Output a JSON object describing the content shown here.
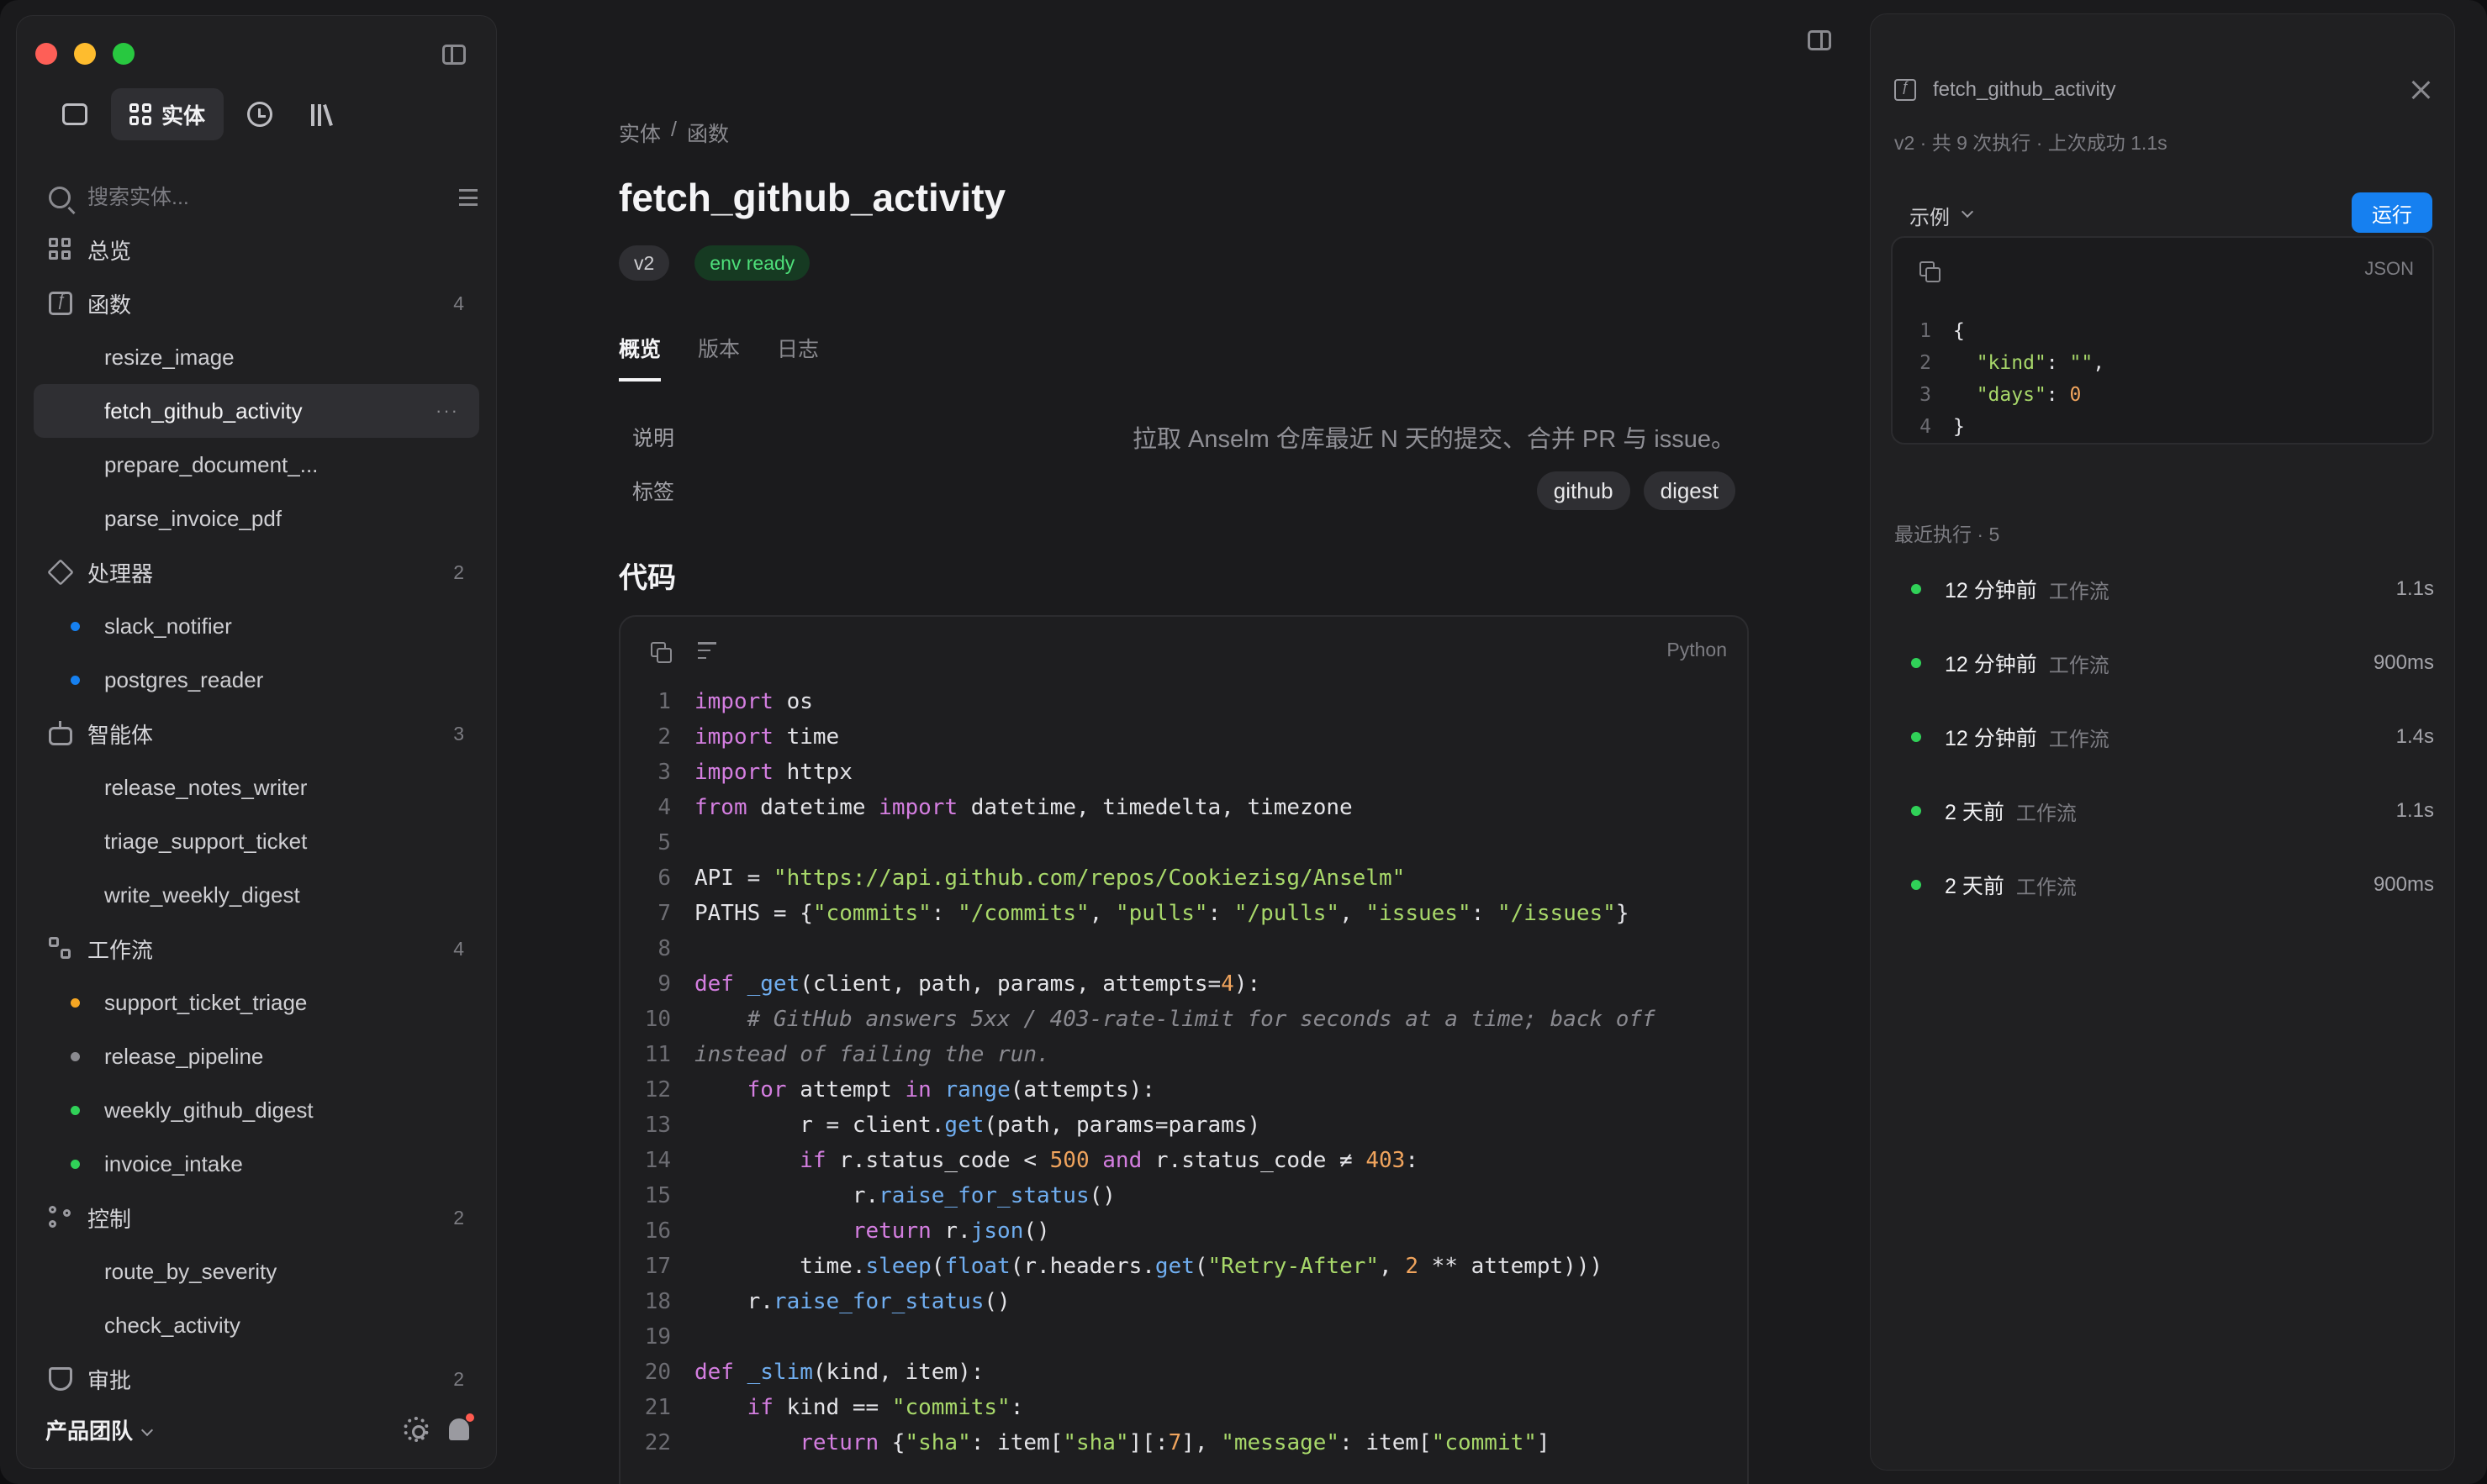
{
  "sidebar": {
    "modes": {
      "entities_label": "实体"
    },
    "search_placeholder": "搜索实体...",
    "overview": "总览",
    "groups": [
      {
        "label": "函数",
        "count": "4",
        "items": [
          {
            "label": "resize_image"
          },
          {
            "label": "fetch_github_activity",
            "selected": true
          },
          {
            "label": "prepare_document_..."
          },
          {
            "label": "parse_invoice_pdf"
          }
        ]
      },
      {
        "label": "处理器",
        "count": "2",
        "items": [
          {
            "label": "slack_notifier",
            "dot": "#1680f0"
          },
          {
            "label": "postgres_reader",
            "dot": "#1680f0"
          }
        ]
      },
      {
        "label": "智能体",
        "count": "3",
        "items": [
          {
            "label": "release_notes_writer"
          },
          {
            "label": "triage_support_ticket"
          },
          {
            "label": "write_weekly_digest"
          }
        ]
      },
      {
        "label": "工作流",
        "count": "4",
        "items": [
          {
            "label": "support_ticket_triage",
            "dot": "#f5a623"
          },
          {
            "label": "release_pipeline",
            "dot": "#8a8a8f"
          },
          {
            "label": "weekly_github_digest",
            "dot": "#30d158"
          },
          {
            "label": "invoice_intake",
            "dot": "#30d158"
          }
        ]
      },
      {
        "label": "控制",
        "count": "2",
        "items": [
          {
            "label": "route_by_severity"
          },
          {
            "label": "check_activity"
          }
        ]
      },
      {
        "label": "审批",
        "count": "2",
        "items": []
      }
    ],
    "footer": {
      "team": "产品团队"
    }
  },
  "main": {
    "breadcrumb": [
      "实体",
      "/",
      "函数"
    ],
    "title": "fetch_github_activity",
    "badges": {
      "version": "v2",
      "env": "env ready"
    },
    "tabs": [
      "概览",
      "版本",
      "日志"
    ],
    "props": {
      "desc_label": "说明",
      "desc_value": "拉取 Anselm 仓库最近 N 天的提交、合并 PR 与 issue。",
      "tags_label": "标签",
      "tags": [
        "github",
        "digest"
      ]
    },
    "code_title": "代码",
    "code_lang": "Python",
    "code_lines": [
      [
        [
          "kw",
          "import"
        ],
        [
          "t",
          " os"
        ]
      ],
      [
        [
          "kw",
          "import"
        ],
        [
          "t",
          " time"
        ]
      ],
      [
        [
          "kw",
          "import"
        ],
        [
          "t",
          " httpx"
        ]
      ],
      [
        [
          "kw",
          "from"
        ],
        [
          "t",
          " datetime "
        ],
        [
          "kw",
          "import"
        ],
        [
          "t",
          " datetime, timedelta, timezone"
        ]
      ],
      [],
      [
        [
          "t",
          "API = "
        ],
        [
          "str",
          "\"https://api.github.com/repos/Cookiezisg/Anselm\""
        ]
      ],
      [
        [
          "t",
          "PATHS = {"
        ],
        [
          "str",
          "\"commits\""
        ],
        [
          "t",
          ": "
        ],
        [
          "str",
          "\"/commits\""
        ],
        [
          "t",
          ", "
        ],
        [
          "str",
          "\"pulls\""
        ],
        [
          "t",
          ": "
        ],
        [
          "str",
          "\"/pulls\""
        ],
        [
          "t",
          ", "
        ],
        [
          "str",
          "\"issues\""
        ],
        [
          "t",
          ": "
        ],
        [
          "str",
          "\"/issues\""
        ],
        [
          "t",
          "}"
        ]
      ],
      [],
      [
        [
          "kw",
          "def"
        ],
        [
          "t",
          " "
        ],
        [
          "fn",
          "_get"
        ],
        [
          "t",
          "(client, path, params, attempts="
        ],
        [
          "num",
          "4"
        ],
        [
          "t",
          "):"
        ]
      ],
      [
        [
          "cm",
          "    # GitHub answers 5xx / 403-rate-limit for seconds at a time; back off"
        ]
      ],
      [
        [
          "cm",
          "instead of failing the run."
        ]
      ],
      [
        [
          "t",
          "    "
        ],
        [
          "kw",
          "for"
        ],
        [
          "t",
          " attempt "
        ],
        [
          "kw",
          "in"
        ],
        [
          "t",
          " "
        ],
        [
          "fn",
          "range"
        ],
        [
          "t",
          "(attempts):"
        ]
      ],
      [
        [
          "t",
          "        r = client."
        ],
        [
          "fn",
          "get"
        ],
        [
          "t",
          "(path, params=params)"
        ]
      ],
      [
        [
          "t",
          "        "
        ],
        [
          "kw",
          "if"
        ],
        [
          "t",
          " r.status_code < "
        ],
        [
          "num",
          "500"
        ],
        [
          "t",
          " "
        ],
        [
          "kw",
          "and"
        ],
        [
          "t",
          " r.status_code ≠ "
        ],
        [
          "num",
          "403"
        ],
        [
          "t",
          ":"
        ]
      ],
      [
        [
          "t",
          "            r."
        ],
        [
          "fn",
          "raise_for_status"
        ],
        [
          "t",
          "()"
        ]
      ],
      [
        [
          "t",
          "            "
        ],
        [
          "kw",
          "return"
        ],
        [
          "t",
          " r."
        ],
        [
          "fn",
          "json"
        ],
        [
          "t",
          "()"
        ]
      ],
      [
        [
          "t",
          "        time."
        ],
        [
          "fn",
          "sleep"
        ],
        [
          "t",
          "("
        ],
        [
          "fn",
          "float"
        ],
        [
          "t",
          "(r.headers."
        ],
        [
          "fn",
          "get"
        ],
        [
          "t",
          "("
        ],
        [
          "str",
          "\"Retry-After\""
        ],
        [
          "t",
          ", "
        ],
        [
          "num",
          "2"
        ],
        [
          "t",
          " ** attempt)))"
        ]
      ],
      [
        [
          "t",
          "    r."
        ],
        [
          "fn",
          "raise_for_status"
        ],
        [
          "t",
          "()"
        ]
      ],
      [],
      [
        [
          "kw",
          "def"
        ],
        [
          "t",
          " "
        ],
        [
          "fn",
          "_slim"
        ],
        [
          "t",
          "(kind, item):"
        ]
      ],
      [
        [
          "t",
          "    "
        ],
        [
          "kw",
          "if"
        ],
        [
          "t",
          " kind == "
        ],
        [
          "str",
          "\"commits\""
        ],
        [
          "t",
          ":"
        ]
      ],
      [
        [
          "t",
          "        "
        ],
        [
          "kw",
          "return"
        ],
        [
          "t",
          " {"
        ],
        [
          "str",
          "\"sha\""
        ],
        [
          "t",
          ": item["
        ],
        [
          "str",
          "\"sha\""
        ],
        [
          "t",
          "][:"
        ],
        [
          "num",
          "7"
        ],
        [
          "t",
          "], "
        ],
        [
          "str",
          "\"message\""
        ],
        [
          "t",
          ": item["
        ],
        [
          "str",
          "\"commit\""
        ],
        [
          "t",
          "]"
        ]
      ]
    ]
  },
  "panel": {
    "title": "fetch_github_activity",
    "meta": "v2 · 共 9 次执行 · 上次成功 1.1s",
    "example_label": "示例",
    "run_label": "运行",
    "json_lang": "JSON",
    "json_lines": [
      [
        [
          "t",
          "{"
        ]
      ],
      [
        [
          "t",
          "  "
        ],
        [
          "str",
          "\"kind\""
        ],
        [
          "t",
          ": "
        ],
        [
          "str",
          "\"\""
        ],
        [
          "t",
          ","
        ]
      ],
      [
        [
          "t",
          "  "
        ],
        [
          "str",
          "\"days\""
        ],
        [
          "t",
          ": "
        ],
        [
          "num",
          "0"
        ]
      ],
      [
        [
          "t",
          "}"
        ]
      ]
    ],
    "runs_title": "最近执行 · 5",
    "runs": [
      {
        "time": "12 分钟前",
        "type": "工作流",
        "duration": "1.1s"
      },
      {
        "time": "12 分钟前",
        "type": "工作流",
        "duration": "900ms"
      },
      {
        "time": "12 分钟前",
        "type": "工作流",
        "duration": "1.4s"
      },
      {
        "time": "2 天前",
        "type": "工作流",
        "duration": "1.1s"
      },
      {
        "time": "2 天前",
        "type": "工作流",
        "duration": "900ms"
      }
    ]
  }
}
